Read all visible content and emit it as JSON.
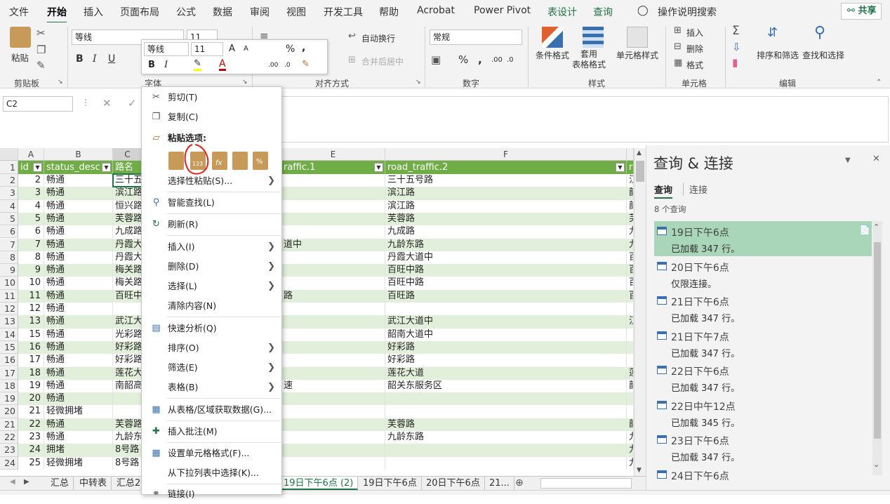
{
  "ribbon_tabs": [
    "文件",
    "开始",
    "插入",
    "页面布局",
    "公式",
    "数据",
    "审阅",
    "视图",
    "开发工具",
    "帮助",
    "Acrobat",
    "Power Pivot",
    "表设计",
    "查询"
  ],
  "tell_me": "操作说明搜索",
  "share_label": "共享",
  "groups": {
    "clipboard": {
      "label": "剪贴板",
      "paste": "粘贴"
    },
    "font": {
      "label": "字体",
      "name": "等线",
      "size": "11"
    },
    "alignment": {
      "label": "对齐方式",
      "wrap": "自动换行",
      "merge": "合并后居中"
    },
    "number": {
      "label": "数字",
      "format": "常规"
    },
    "styles": {
      "label": "样式",
      "conditional": "条件格式",
      "table_format": "套用\n表格格式",
      "cell_styles": "单元格样式"
    },
    "cells": {
      "label": "单元格",
      "insert": "插入",
      "delete": "删除",
      "format": "格式"
    },
    "editing": {
      "label": "编辑",
      "sort": "排序和筛选",
      "find": "查找和选择"
    }
  },
  "mini_toolbar": {
    "font": "等线",
    "size": "11"
  },
  "name_box": "C2",
  "columns": [
    "A",
    "B",
    "C",
    "D",
    "E",
    "F"
  ],
  "table_headers": [
    "id",
    "status_desc",
    "路名",
    "raffic.1",
    "road_traffic.2",
    "r"
  ],
  "rows": [
    {
      "n": "2",
      "id": "2",
      "s": "畅通",
      "c": "三十五",
      "e": "",
      "f": "三十五号路",
      "g": "江"
    },
    {
      "n": "3",
      "id": "3",
      "s": "畅通",
      "c": "滨江路",
      "e": "",
      "f": "滨江路",
      "g": "韶"
    },
    {
      "n": "4",
      "id": "4",
      "s": "畅通",
      "c": "恒兴路",
      "e": "",
      "f": "滨江路",
      "g": "韶"
    },
    {
      "n": "5",
      "id": "5",
      "s": "畅通",
      "c": "芙蓉路",
      "e": "",
      "f": "芙蓉路",
      "g": "芙"
    },
    {
      "n": "6",
      "id": "6",
      "s": "畅通",
      "c": "九成路",
      "e": "",
      "f": "九成路",
      "g": "九"
    },
    {
      "n": "7",
      "id": "7",
      "s": "畅通",
      "c": "丹霞大",
      "e": "道中",
      "f": "九龄东路",
      "g": "九"
    },
    {
      "n": "8",
      "id": "8",
      "s": "畅通",
      "c": "丹霞大",
      "e": "",
      "f": "丹霞大道中",
      "g": "百"
    },
    {
      "n": "9",
      "id": "9",
      "s": "畅通",
      "c": "梅关路",
      "e": "",
      "f": "百旺中路",
      "g": "百"
    },
    {
      "n": "10",
      "id": "10",
      "s": "畅通",
      "c": "梅关路",
      "e": "",
      "f": "百旺中路",
      "g": "百"
    },
    {
      "n": "11",
      "id": "11",
      "s": "畅通",
      "c": "百旺中",
      "e": "路",
      "f": "百旺路",
      "g": "百"
    },
    {
      "n": "12",
      "id": "12",
      "s": "畅通",
      "c": "",
      "e": "",
      "f": "",
      "g": ""
    },
    {
      "n": "13",
      "id": "13",
      "s": "畅通",
      "c": "武江大",
      "e": "",
      "f": "武江大道中",
      "g": "江"
    },
    {
      "n": "14",
      "id": "15",
      "s": "畅通",
      "c": "光彩路",
      "e": "",
      "f": "韶南大道中",
      "g": ""
    },
    {
      "n": "15",
      "id": "16",
      "s": "畅通",
      "c": "好彩路",
      "e": "",
      "f": "好彩路",
      "g": ""
    },
    {
      "n": "16",
      "id": "17",
      "s": "畅通",
      "c": "好彩路",
      "e": "",
      "f": "好彩路",
      "g": ""
    },
    {
      "n": "17",
      "id": "18",
      "s": "畅通",
      "c": "莲花大",
      "e": "",
      "f": "莲花大道",
      "g": "莲"
    },
    {
      "n": "18",
      "id": "19",
      "s": "畅通",
      "c": "南韶高",
      "e": "速",
      "f": "韶关东服务区",
      "g": "韶"
    },
    {
      "n": "19",
      "id": "20",
      "s": "畅通",
      "c": "",
      "e": "",
      "f": "",
      "g": ""
    },
    {
      "n": "20",
      "id": "21",
      "s": "轻微拥堵",
      "c": "",
      "e": "",
      "f": "",
      "g": ""
    },
    {
      "n": "21",
      "id": "22",
      "s": "畅通",
      "c": "芙蓉路",
      "e": "",
      "f": "芙蓉路",
      "g": "韶"
    },
    {
      "n": "22",
      "id": "23",
      "s": "畅通",
      "c": "九龄东",
      "e": "",
      "f": "九龄东路",
      "g": "九"
    },
    {
      "n": "23",
      "id": "24",
      "s": "拥堵",
      "c": "8号路",
      "e": "",
      "f": "",
      "g": "九"
    },
    {
      "n": "24",
      "id": "25",
      "s": "轻微拥堵",
      "c": "8号路",
      "e": "",
      "f": "",
      "g": "九"
    }
  ],
  "context_menu": {
    "cut": "剪切(T)",
    "copy": "复制(C)",
    "paste_options": "粘贴选项:",
    "paste_special": "选择性粘贴(S)...",
    "smart_lookup": "智能查找(L)",
    "refresh": "刷新(R)",
    "insert": "插入(I)",
    "delete": "删除(D)",
    "select": "选择(L)",
    "clear": "清除内容(N)",
    "quick_analysis": "快速分析(Q)",
    "sort": "排序(O)",
    "filter": "筛选(E)",
    "table": "表格(B)",
    "from_table": "从表格/区域获取数据(G)...",
    "insert_comment": "插入批注(M)",
    "format_cells": "设置单元格格式(F)...",
    "pick_list": "从下拉列表中选择(K)...",
    "link": "链接(I)"
  },
  "sheet_tabs": [
    "汇总",
    "中转表",
    "汇总2",
    "19日下午6点 (2)",
    "19日下午6点",
    "20日下午6点",
    "21..."
  ],
  "query_pane": {
    "title": "查询 & 连接",
    "tab_queries": "查询",
    "tab_connections": "连接",
    "count": "8 个查询",
    "items": [
      {
        "name": "19日下午6点",
        "status": "已加载 347 行。"
      },
      {
        "name": "20日下午6点",
        "status": "仅限连接。"
      },
      {
        "name": "21日下午6点",
        "status": "已加载 347 行。"
      },
      {
        "name": "21日下午7点",
        "status": "已加载 347 行。"
      },
      {
        "name": "22日下午6点",
        "status": "已加载 347 行。"
      },
      {
        "name": "22日中午12点",
        "status": "已加载 345 行。"
      },
      {
        "name": "23日下午6点",
        "status": "已加载 347 行。"
      },
      {
        "name": "24日下午6点",
        "status": ""
      }
    ]
  },
  "colors": {
    "accent": "#217346",
    "header_green": "#70ad47",
    "band": "#e2efda",
    "selected_query": "#a9d6b8",
    "annotation_red": "#e02020"
  }
}
